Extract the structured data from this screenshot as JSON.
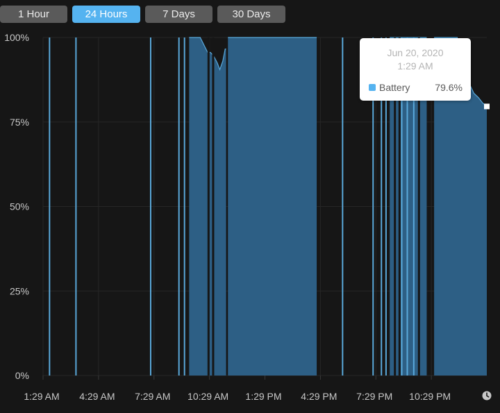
{
  "range_buttons": [
    {
      "label": "1 Hour",
      "active": false
    },
    {
      "label": "24 Hours",
      "active": true
    },
    {
      "label": "7 Days",
      "active": false
    },
    {
      "label": "30 Days",
      "active": false
    }
  ],
  "colors": {
    "accent": "#55b3f0",
    "fill": "#2d5f85",
    "line": "#5aa9db",
    "background": "#161616",
    "grid": "#262626",
    "axis_text": "#c8c8c8"
  },
  "tooltip": {
    "date": "Jun 20, 2020",
    "time": "1:29 AM",
    "series": "Battery",
    "value": "79.6%"
  },
  "icons": {
    "time_picker": "clock-icon"
  },
  "chart_data": {
    "type": "area",
    "series": [
      {
        "name": "Battery"
      }
    ],
    "y_ticks": [
      "100%",
      "75%",
      "50%",
      "25%",
      "0%"
    ],
    "ylim": [
      0,
      100
    ],
    "x_ticks": [
      "1:29 AM",
      "4:29 AM",
      "7:29 AM",
      "10:29 AM",
      "1:29 PM",
      "4:29 PM",
      "7:29 PM",
      "10:29 PM"
    ],
    "x_tick_hours": [
      0,
      3,
      6,
      9,
      12,
      15,
      18,
      21
    ],
    "xlim_hours": [
      0,
      24
    ],
    "grid": true,
    "spikes": [
      {
        "hour": 0.35,
        "value": 100
      },
      {
        "hour": 1.78,
        "value": 100
      },
      {
        "hour": 5.82,
        "value": 100
      },
      {
        "hour": 7.35,
        "value": 100
      },
      {
        "hour": 7.65,
        "value": 100
      },
      {
        "hour": 16.2,
        "value": 100
      },
      {
        "hour": 17.85,
        "value": 100
      },
      {
        "hour": 18.3,
        "value": 100
      },
      {
        "hour": 18.55,
        "value": 100
      },
      {
        "hour": 19.4,
        "value": 100
      },
      {
        "hour": 19.7,
        "value": 100
      },
      {
        "hour": 20.05,
        "value": 100
      }
    ],
    "segments": [
      {
        "points": [
          [
            7.9,
            100
          ],
          [
            8.5,
            100
          ],
          [
            8.9,
            95.6
          ],
          [
            9.05,
            95.6
          ],
          [
            9.22,
            94.6
          ],
          [
            9.42,
            92.5
          ],
          [
            9.56,
            90.5
          ],
          [
            9.72,
            93.0
          ],
          [
            9.85,
            96.6
          ],
          [
            9.9,
            96.6
          ]
        ]
      },
      {
        "points": [
          [
            10.0,
            100
          ],
          [
            14.8,
            100
          ]
        ]
      },
      {
        "points": [
          [
            18.75,
            100
          ],
          [
            20.75,
            100
          ]
        ]
      },
      {
        "points": [
          [
            21.15,
            100
          ],
          [
            22.4,
            100
          ],
          [
            22.75,
            91.6
          ],
          [
            23.05,
            86.4
          ],
          [
            23.3,
            83.5
          ],
          [
            23.55,
            82.2
          ],
          [
            23.78,
            80.6
          ],
          [
            24.0,
            79.6
          ]
        ]
      }
    ],
    "gaps": [
      {
        "hour": 8.95,
        "value": 100
      },
      {
        "hour": 9.2,
        "value": 100
      },
      {
        "hour": 19.03,
        "value": 100
      },
      {
        "hour": 19.28,
        "value": 100
      },
      {
        "hour": 20.33,
        "value": 100
      }
    ],
    "highlight": {
      "hour": 24.0,
      "value": 79.6
    }
  }
}
